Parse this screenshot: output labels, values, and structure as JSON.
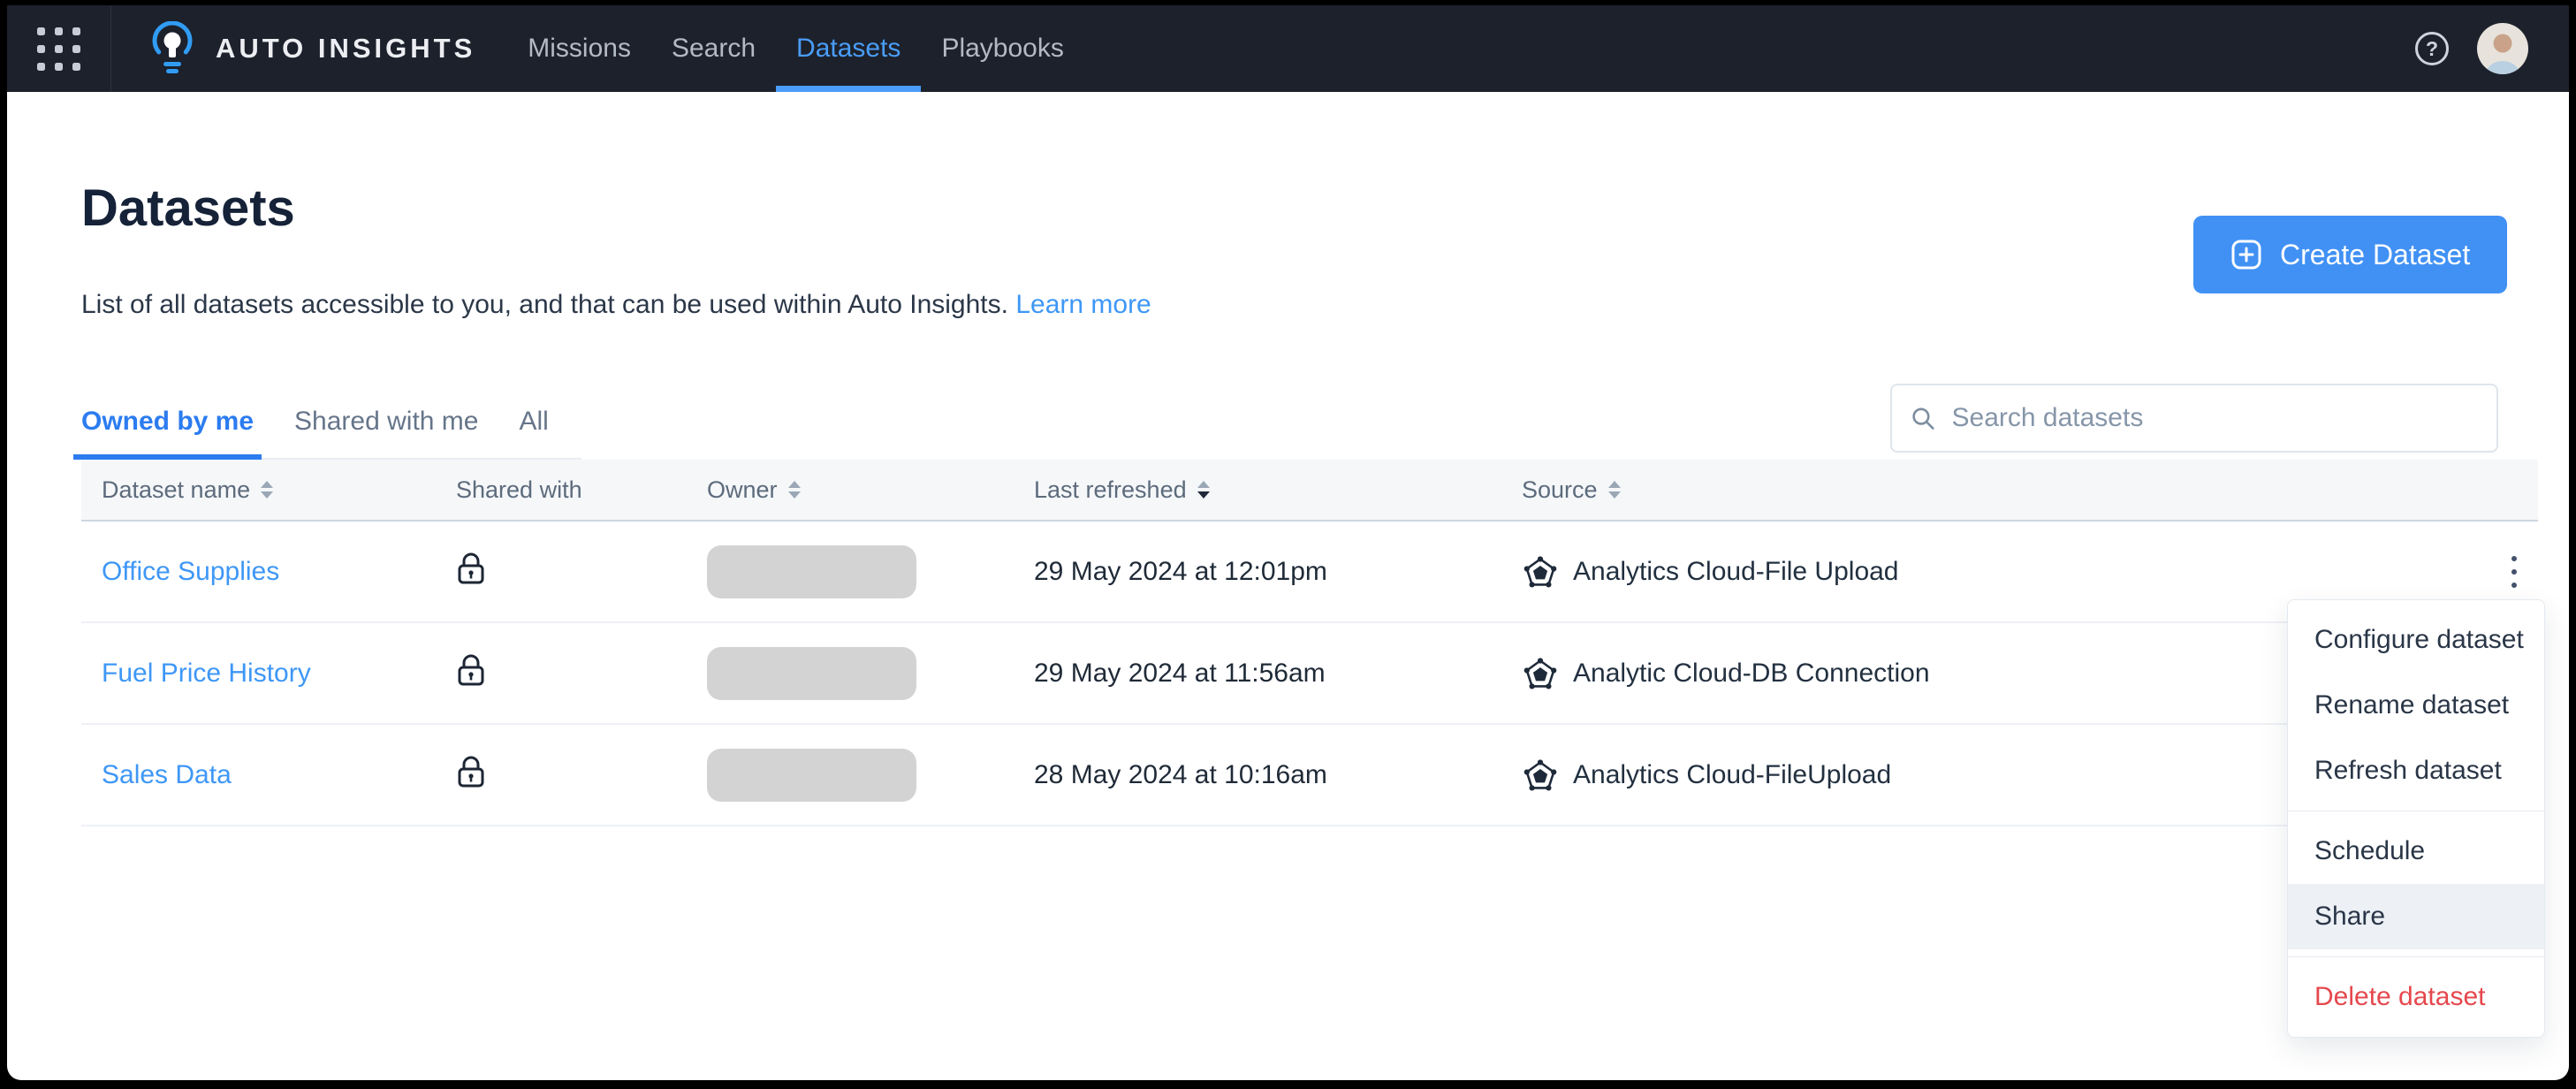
{
  "topbar": {
    "brand": "AUTO INSIGHTS",
    "apps_icon": "grid-icon",
    "logo_icon": "lightbulb-icon",
    "nav_items": [
      {
        "label": "Missions",
        "active": false
      },
      {
        "label": "Search",
        "active": false
      },
      {
        "label": "Datasets",
        "active": true
      },
      {
        "label": "Playbooks",
        "active": false
      }
    ],
    "help_icon": "help-icon",
    "avatar_icon": "user-avatar"
  },
  "page": {
    "title": "Datasets",
    "description": "List of all datasets accessible to you, and that can be used within Auto Insights.",
    "learn_more_label": "Learn more",
    "create_button_label": "Create Dataset"
  },
  "tabs": [
    {
      "label": "Owned by me",
      "active": true
    },
    {
      "label": "Shared with me",
      "active": false
    },
    {
      "label": "All",
      "active": false
    }
  ],
  "search": {
    "placeholder": "Search datasets",
    "icon": "search-icon"
  },
  "table": {
    "columns": [
      {
        "label": "Dataset name",
        "sort": "none"
      },
      {
        "label": "Shared with",
        "sort": null
      },
      {
        "label": "Owner",
        "sort": "none"
      },
      {
        "label": "Last refreshed",
        "sort": "desc"
      },
      {
        "label": "Source",
        "sort": "none"
      },
      {
        "label": "",
        "sort": null
      }
    ],
    "rows": [
      {
        "name": "Office Supplies",
        "shared_with_icon": "lock-icon",
        "owner_redacted": true,
        "last_refreshed": "29 May 2024 at 12:01pm",
        "source": "Analytics Cloud-File Upload",
        "source_icon": "analytics-cloud-icon",
        "actions_icon": "kebab-menu-icon"
      },
      {
        "name": "Fuel Price History",
        "shared_with_icon": "lock-icon",
        "owner_redacted": true,
        "last_refreshed": "29 May 2024 at 11:56am",
        "source": "Analytic Cloud-DB Connection",
        "source_icon": "analytics-cloud-icon",
        "actions_icon": "kebab-menu-icon"
      },
      {
        "name": "Sales Data",
        "shared_with_icon": "lock-icon",
        "owner_redacted": true,
        "last_refreshed": "28 May 2024 at 10:16am",
        "source": "Analytics Cloud-FileUpload",
        "source_icon": "analytics-cloud-icon",
        "actions_icon": "kebab-menu-icon"
      }
    ]
  },
  "context_menu": {
    "groups": [
      {
        "items": [
          {
            "label": "Configure dataset",
            "highlighted": false,
            "danger": false
          },
          {
            "label": "Rename dataset",
            "highlighted": false,
            "danger": false
          },
          {
            "label": "Refresh dataset",
            "highlighted": false,
            "danger": false
          }
        ]
      },
      {
        "items": [
          {
            "label": "Schedule",
            "highlighted": false,
            "danger": false
          },
          {
            "label": "Share",
            "highlighted": true,
            "danger": false
          }
        ]
      },
      {
        "items": [
          {
            "label": "Delete dataset",
            "highlighted": false,
            "danger": true
          }
        ]
      }
    ]
  },
  "colors": {
    "accent": "#4191f4",
    "topbar_bg": "#1c212c",
    "nav_active": "#4a9df8",
    "link": "#3e97f6",
    "danger": "#e5484d",
    "redacted_pill": "#d3d3d3"
  }
}
